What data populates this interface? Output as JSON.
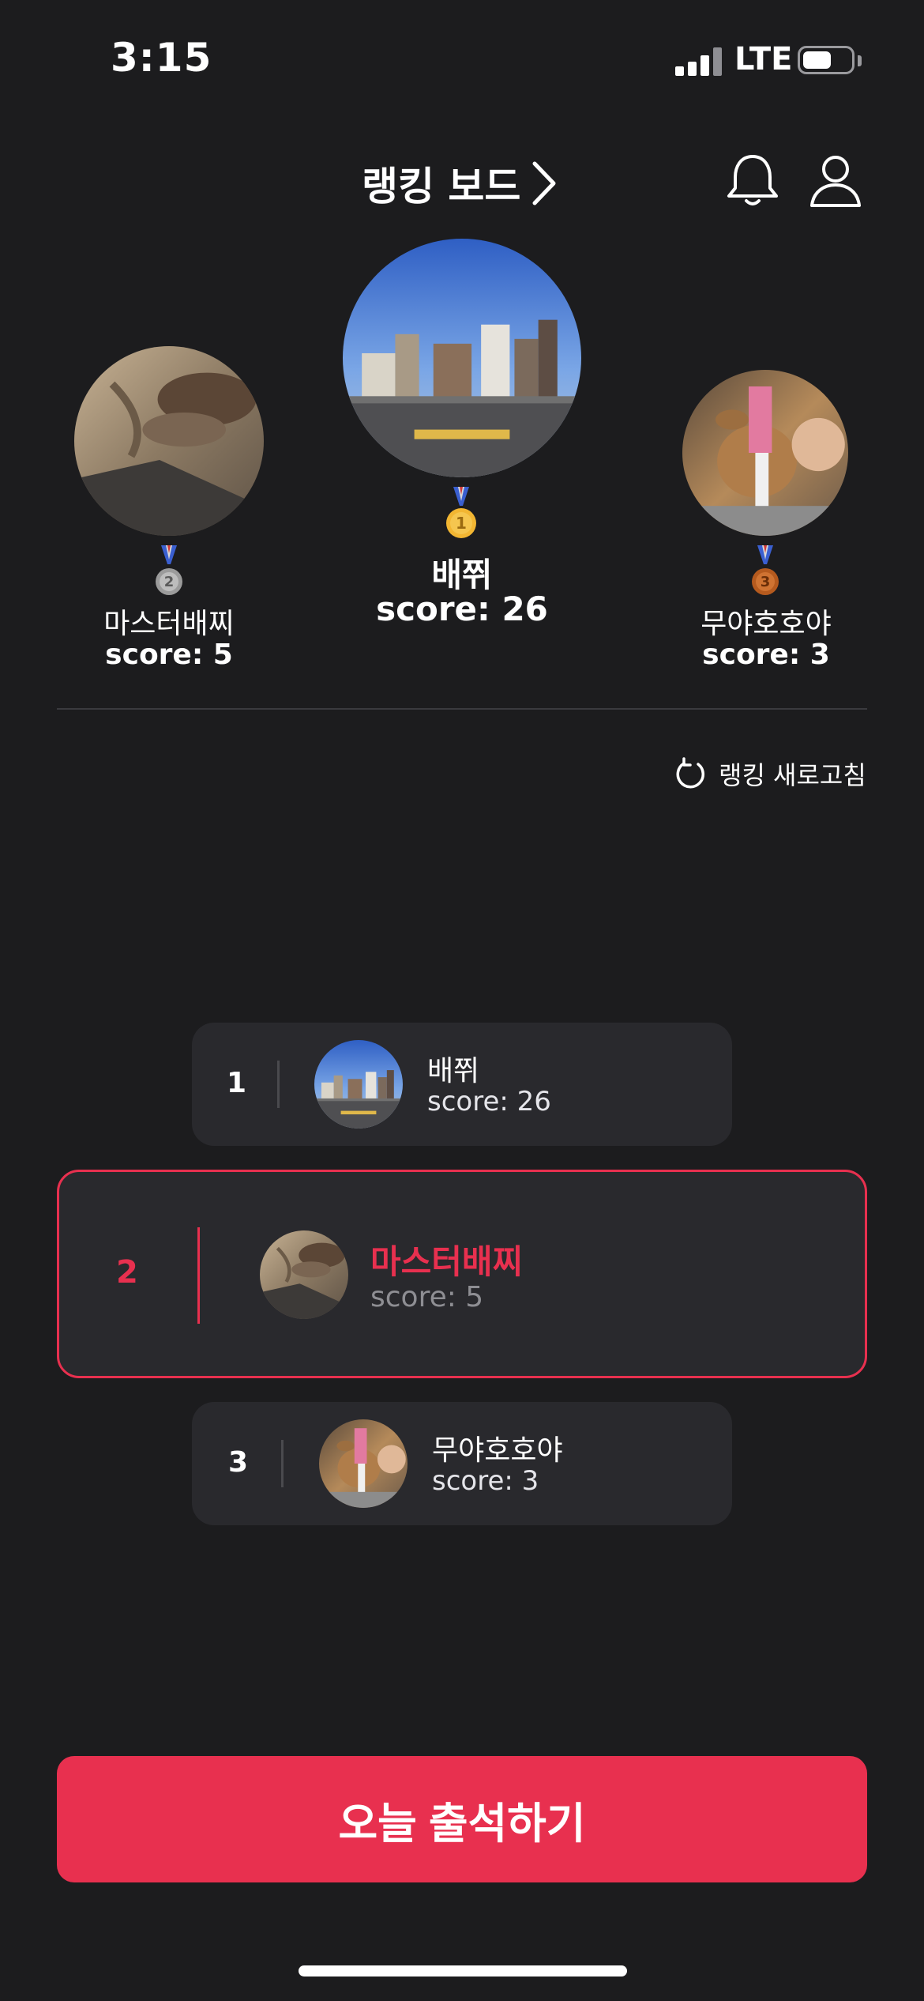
{
  "status_bar": {
    "time": "3:15",
    "network": "LTE",
    "battery_level": 0.6
  },
  "header": {
    "title": "랭킹 보드"
  },
  "podium": {
    "first": {
      "rank": 1,
      "name": "배쮜",
      "score_label": "score: 26",
      "medal": "gold-medal-icon",
      "medal_number": "1"
    },
    "second": {
      "rank": 2,
      "name": "마스터배찌",
      "score_label": "score: 5",
      "medal": "silver-medal-icon",
      "medal_number": "2"
    },
    "third": {
      "rank": 3,
      "name": "무야호호야",
      "score_label": "score: 3",
      "medal": "bronze-medal-icon",
      "medal_number": "3"
    }
  },
  "refresh": {
    "label": "랭킹 새로고침"
  },
  "ranking_list": [
    {
      "rank": "1",
      "name": "배쮜",
      "score_label": "score: 26",
      "highlighted": false
    },
    {
      "rank": "2",
      "name": "마스터배찌",
      "score_label": "score: 5",
      "highlighted": true
    },
    {
      "rank": "3",
      "name": "무야호호야",
      "score_label": "score: 3",
      "highlighted": false
    }
  ],
  "cta": {
    "label": "오늘 출석하기"
  },
  "colors": {
    "background": "#1c1c1e",
    "card": "#29292d",
    "accent": "#e8304f",
    "gold": "#f2b632",
    "silver": "#9b9b9b",
    "bronze": "#b55a1e"
  }
}
